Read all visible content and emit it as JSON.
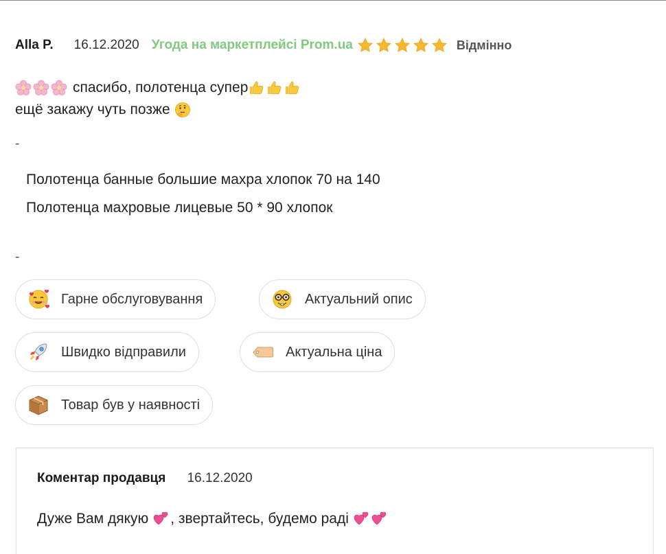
{
  "review": {
    "author": "Alla P.",
    "date": "16.12.2020",
    "deal_text": "Угода на маркетплейсі Prom.ua",
    "stars": 5,
    "rating_label": "Відмінно",
    "line1_text": "спасибо, полотенца супер",
    "line2_text": "ещё закажу чуть позже",
    "separator": "-",
    "products": [
      "Полотенца банные большие махра хлопок 70 на 140",
      "Полотенца махровые лицевые 50 * 90 хлопок"
    ]
  },
  "tags": [
    {
      "label": "Гарне обслуговування",
      "icon": "smiling-face-with-hearts-icon"
    },
    {
      "label": "Актуальний опис",
      "icon": "nerd-face-icon"
    },
    {
      "label": "Швидко відправили",
      "icon": "rocket-icon"
    },
    {
      "label": "Актуальна ціна",
      "icon": "price-tag-icon"
    },
    {
      "label": "Товар був у наявності",
      "icon": "package-icon"
    }
  ],
  "seller_comment": {
    "title": "Коментар продавця",
    "date": "16.12.2020",
    "text_part1": "Дуже Вам дякую",
    "text_part2": ", звертайтесь, будемо раді"
  },
  "colors": {
    "deal_green": "#7fca80",
    "star_gold": "#f5b82e",
    "border_gray": "#dddddd"
  }
}
